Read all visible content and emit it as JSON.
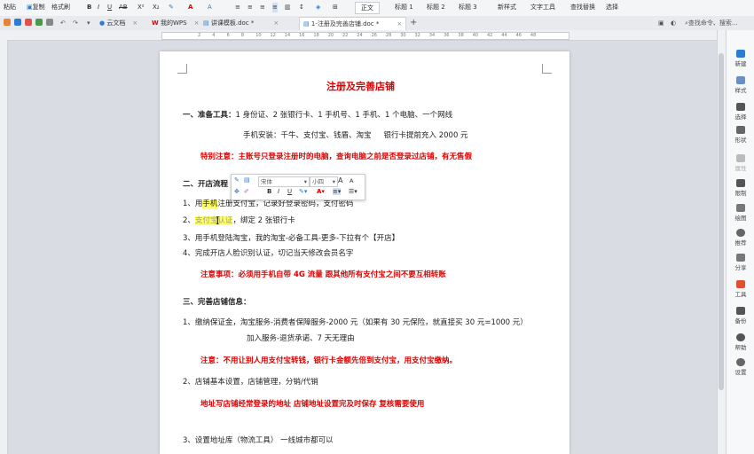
{
  "toolbar": {
    "paste": "粘贴",
    "copy": "复制",
    "format_painter": "格式刷",
    "bold": "B",
    "italic": "I",
    "underline": "U",
    "strikeout": "AB",
    "superscript": "X²",
    "subscript": "X₂",
    "style_normal": "正文",
    "style_h1": "标题 1",
    "style_h2": "标题 2",
    "style_h3": "标题 3",
    "new_style": "新样式",
    "text_tools": "文字工具",
    "find_replace": "查找替换",
    "select": "选择",
    "search_placeholder": "查找命令、搜索..."
  },
  "tabs": [
    {
      "label": "云文档"
    },
    {
      "label": "我的WPS"
    },
    {
      "label": "讲课模板.doc *"
    },
    {
      "label": "1-注册及完善店铺.doc *"
    }
  ],
  "tab_add": "+",
  "tab_close": "×",
  "ruler_numbers": [
    "2",
    "4",
    "6",
    "8",
    "10",
    "12",
    "14",
    "16",
    "18",
    "20",
    "22",
    "24",
    "26",
    "28",
    "30",
    "32",
    "34",
    "36",
    "38",
    "40",
    "42",
    "44",
    "46",
    "48"
  ],
  "document": {
    "title": "注册及完善店铺",
    "s1_head": "一、准备工具：",
    "s1_text": "1 身份证、2 张银行卡、1 手机号、1 手机、1 个电脑、一个网线",
    "s1_apps": "手机安装：千牛、支付宝、钱盾、淘宝",
    "s1_bank": "银行卡提前充入 2000 元",
    "s1_special": "特别注意：主账号只登录注册时的电脑，查询电脑之前是否登录过店铺，有无售假",
    "s2_head": "二、开店流程",
    "s2_1a": "1、用",
    "s2_1b": "手机",
    "s2_1c": "注册支付宝，记录好登录密码，支付密码",
    "s2_2a": "2、",
    "s2_2b": "支付宝认证",
    "s2_2c": "，绑定 2 张银行卡",
    "s2_3": "3、用手机登陆淘宝，我的淘宝-必备工具-更多-下拉有个【开店】",
    "s2_4": "4、完成开店人脸识别认证，切记当天修改会员名字",
    "s2_note": "注意事项：必须用手机自带 4G 流量 跟其他所有支付宝之间不要互相转账",
    "s3_head": "三、完善店铺信息：",
    "s3_1": "1、缴纳保证金，淘宝服务-消费者保障服务-2000 元（如果有 30 元保险，就直接买 30 元=1000 元）",
    "s3_1b": "加入服务-退货承诺、7 天无理由",
    "s3_note": "注意：不用让别人用支付宝转钱，银行卡金额先倍到支付宝，用支付宝缴纳。",
    "s3_2": "2、店铺基本设置，店铺管理，分销/代销",
    "s3_addr": "地址写店铺经常登录的地址 店铺地址设置完及时保存 复核需要使用",
    "s3_3": "3、设置地址库（物流工具） 一线城市都可以"
  },
  "mini_toolbar": {
    "font": "宋体",
    "size": "小四",
    "grow": "A",
    "shrink": "A",
    "bold": "B",
    "italic": "I",
    "underline": "U"
  },
  "sidebar": [
    {
      "label": "新建"
    },
    {
      "label": "样式"
    },
    {
      "label": "选择"
    },
    {
      "label": "形状"
    },
    {
      "label": "属性"
    },
    {
      "label": "限制"
    },
    {
      "label": "绘图"
    },
    {
      "label": "推荐"
    },
    {
      "label": "分享"
    },
    {
      "label": "工具"
    },
    {
      "label": "备份"
    },
    {
      "label": "帮助"
    },
    {
      "label": "设置"
    }
  ],
  "colors": {
    "accent_red": "#e00000",
    "highlight": "#ffff66",
    "wps_blue": "#2b7cd3"
  }
}
